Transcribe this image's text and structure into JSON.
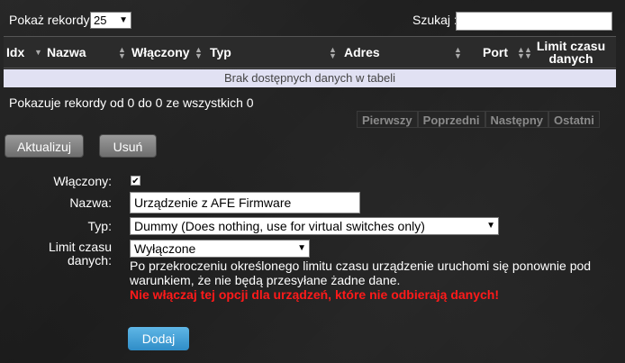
{
  "toolbar": {
    "show_label": "Pokaż rekordy",
    "show_value": "25",
    "search_label": "Szukaj :"
  },
  "table": {
    "columns": [
      "Idx",
      "Nazwa",
      "Włączony",
      "Typ",
      "Adres",
      "Port",
      "Limit czasu danych"
    ],
    "empty_text": "Brak dostępnych danych w tabeli",
    "info": "Pokazuje rekordy od 0 do 0 ze wszystkich 0",
    "pager": [
      "Pierwszy",
      "Poprzedni",
      "Następny",
      "Ostatni"
    ]
  },
  "actions": {
    "update": "Aktualizuj",
    "delete": "Usuń"
  },
  "form": {
    "enabled_label": "Włączony:",
    "enabled_checked": true,
    "name_label": "Nazwa:",
    "name_value": "Urządzenie z AFE Firmware",
    "type_label": "Typ:",
    "type_value": "Dummy (Does nothing, use for virtual switches only)",
    "timeout_label_1": "Limit czasu",
    "timeout_label_2": "danych:",
    "timeout_value": "Wyłączone",
    "help_text": "Po przekroczeniu określonego limitu czasu urządzenie uruchomi się ponownie pod warunkiem, że nie będą przesyłane żadne dane.",
    "warning_text": "Nie włączaj tej opcji dla urządzeń, które nie odbierają danych!",
    "add_button": "Dodaj"
  },
  "colors": {
    "accent": "#3a9ad6",
    "warning": "#ff1a1a",
    "empty_row_bg": "#e1e1f3"
  }
}
